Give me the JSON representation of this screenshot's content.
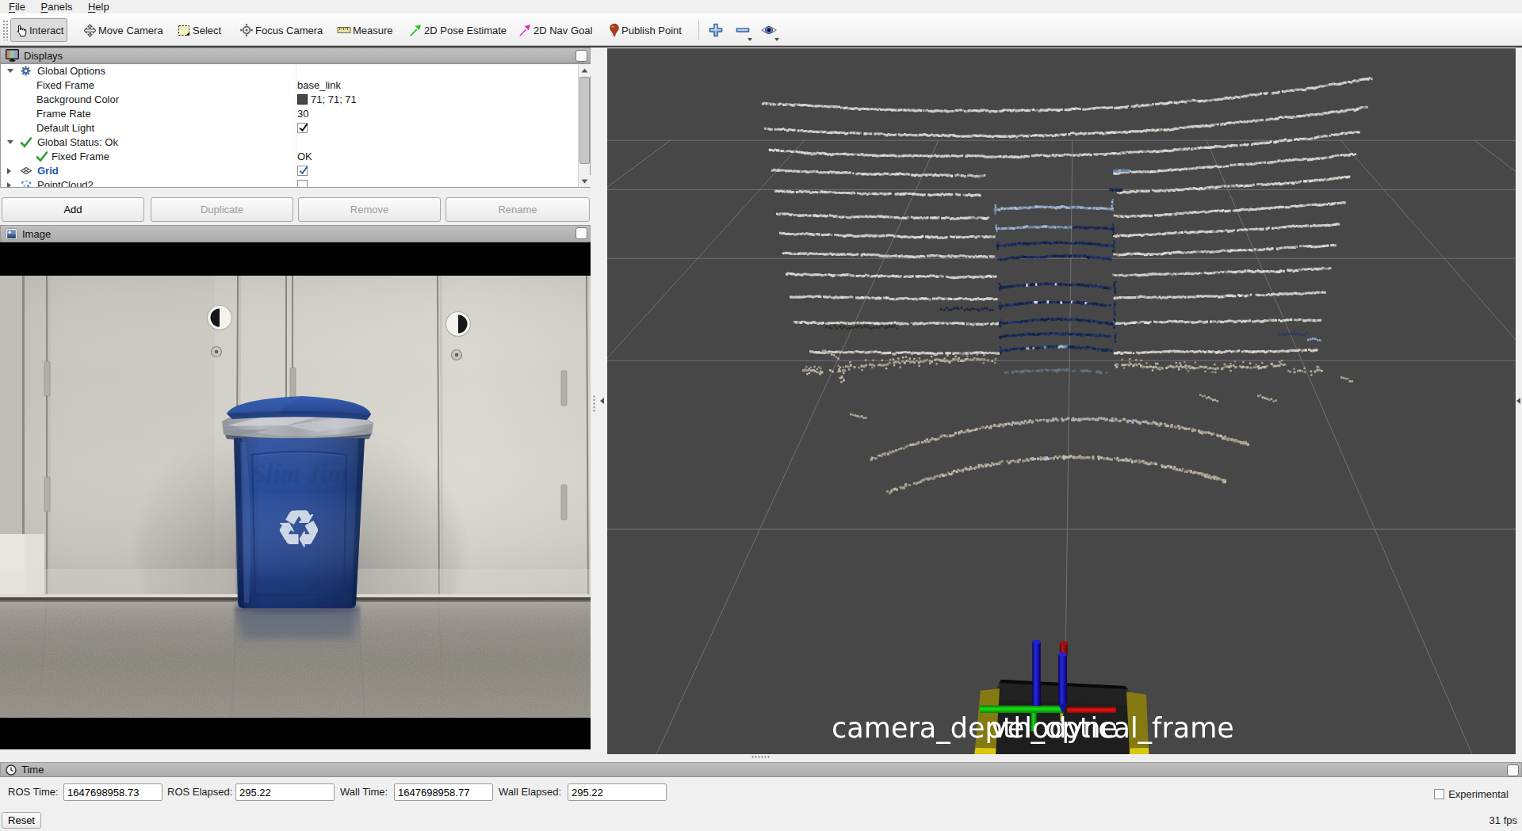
{
  "menu": {
    "items": [
      "File",
      "Panels",
      "Help"
    ]
  },
  "toolbar": {
    "tools": [
      {
        "name": "interact",
        "label": "Interact",
        "checked": true
      },
      {
        "name": "move-camera",
        "label": "Move Camera"
      },
      {
        "name": "select",
        "label": "Select"
      },
      {
        "name": "focus-camera",
        "label": "Focus Camera"
      },
      {
        "name": "measure",
        "label": "Measure"
      },
      {
        "name": "pose-estimate",
        "label": "2D Pose Estimate"
      },
      {
        "name": "nav-goal",
        "label": "2D Nav Goal"
      },
      {
        "name": "publish-point",
        "label": "Publish Point"
      }
    ]
  },
  "displays_panel": {
    "title": "Displays",
    "rows": [
      {
        "label": "Global Options",
        "value": ""
      },
      {
        "label": "Fixed Frame",
        "value": "base_link"
      },
      {
        "label": "Background Color",
        "value": "71; 71; 71",
        "swatch": "#474747"
      },
      {
        "label": "Frame Rate",
        "value": "30"
      },
      {
        "label": "Default Light",
        "checked": true
      },
      {
        "label": "Global Status: Ok",
        "value": ""
      },
      {
        "label": "Fixed Frame",
        "value": "OK"
      },
      {
        "label": "Grid",
        "checked": true
      },
      {
        "label": "PointCloud2",
        "checked": false
      }
    ],
    "buttons": [
      {
        "label": "Add",
        "enabled": true
      },
      {
        "label": "Duplicate",
        "enabled": false
      },
      {
        "label": "Remove",
        "enabled": false
      },
      {
        "label": "Rename",
        "enabled": false
      }
    ]
  },
  "image_panel": {
    "title": "Image",
    "bin_logo_text": "Slim Jim"
  },
  "view3d": {
    "background_color": "#474747",
    "grid_color": "#737375",
    "frame_labels": [
      "camera_depth_optical_frame",
      "velodyne"
    ]
  },
  "time_panel": {
    "title": "Time",
    "fields": [
      {
        "label": "ROS Time:",
        "value": "1647698958.73"
      },
      {
        "label": "ROS Elapsed:",
        "value": "295.22"
      },
      {
        "label": "Wall Time:",
        "value": "1647698958.77"
      },
      {
        "label": "Wall Elapsed:",
        "value": "295.22"
      }
    ],
    "experimental_label": "Experimental",
    "reset_label": "Reset",
    "fps": "31 fps"
  }
}
